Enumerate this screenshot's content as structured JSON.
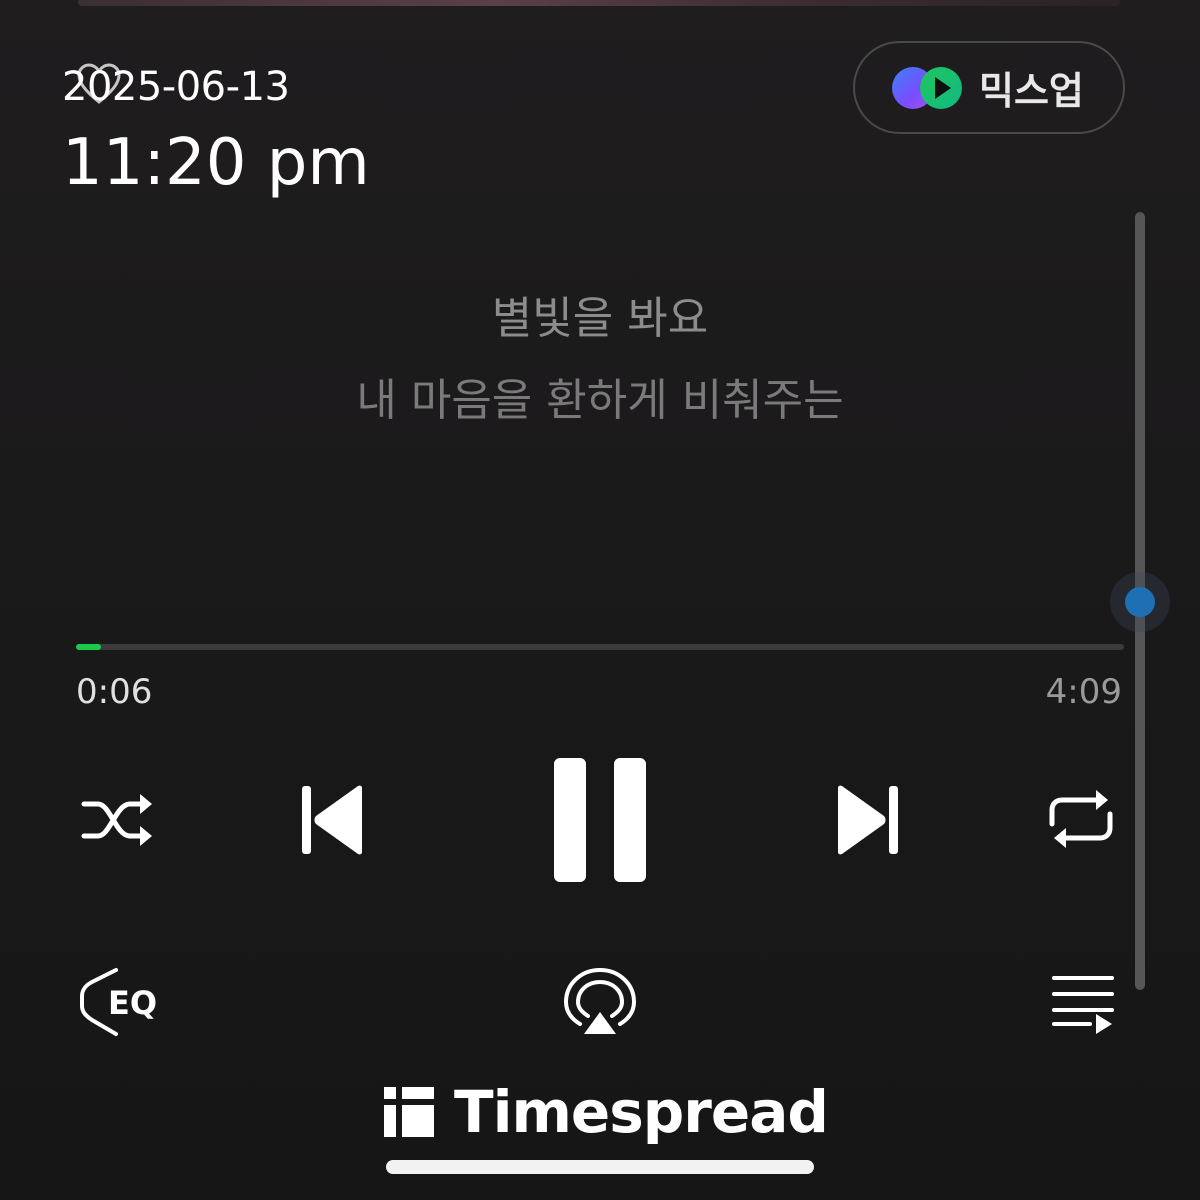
{
  "stamp": {
    "date": "2025-06-13",
    "time": "11:20 pm"
  },
  "mixup": {
    "label": "믹스업",
    "icon": "mixup-logo-icon",
    "colors": {
      "purple": "#7a4cff",
      "green": "#22c55e",
      "blue": "#3b82f6"
    }
  },
  "lyrics": {
    "line1": "별빛을 봐요",
    "line2": "내 마음을 환하게 비춰주는"
  },
  "playback": {
    "elapsed": "0:06",
    "total": "4:09",
    "progress_fraction": 0.024,
    "accent_color": "#19c94a"
  },
  "controls": {
    "shuffle": "shuffle-icon",
    "previous": "skip-previous-icon",
    "pause": "pause-icon",
    "next": "skip-next-icon",
    "repeat": "repeat-icon",
    "eq_label": "EQ",
    "airplay": "airplay-icon",
    "queue": "queue-icon"
  },
  "watermark": {
    "brand": "Timespread"
  }
}
